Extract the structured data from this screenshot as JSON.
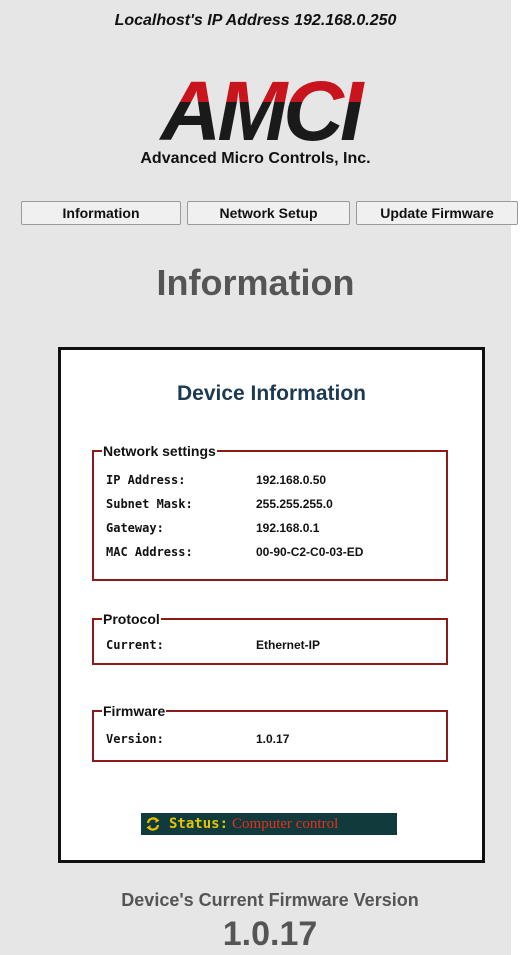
{
  "header": {
    "host_line": "Localhost's IP Address 192.168.0.250",
    "logo_text": "AMCI",
    "company_name": "Advanced Micro Controls, Inc."
  },
  "nav": {
    "buttons": [
      {
        "label": "Information"
      },
      {
        "label": "Network Setup"
      },
      {
        "label": "Update Firmware"
      }
    ]
  },
  "page": {
    "heading": "Information"
  },
  "device": {
    "title": "Device Information",
    "network": {
      "legend": "Network settings",
      "rows": [
        {
          "label": "IP Address:",
          "value": "192.168.0.50"
        },
        {
          "label": "Subnet Mask:",
          "value": "255.255.255.0"
        },
        {
          "label": "Gateway:",
          "value": "192.168.0.1"
        },
        {
          "label": "MAC Address:",
          "value": "00-90-C2-C0-03-ED"
        }
      ]
    },
    "protocol": {
      "legend": "Protocol",
      "label": "Current:",
      "value": "Ethernet-IP"
    },
    "firmware": {
      "legend": "Firmware",
      "label": "Version:",
      "value": "1.0.17"
    },
    "status": {
      "icon": "refresh-icon",
      "label": "Status:",
      "value": "Computer control"
    }
  },
  "footer": {
    "caption": "Device's Current Firmware Version",
    "version": "1.0.17"
  },
  "colors": {
    "logo_red": "#c8141c",
    "logo_black": "#1a1a1a",
    "group_border": "#8b1a1a",
    "title_blue": "#1c3a52",
    "status_bg": "#113a3c",
    "status_label": "#e5c300",
    "status_value": "#e8301b"
  }
}
